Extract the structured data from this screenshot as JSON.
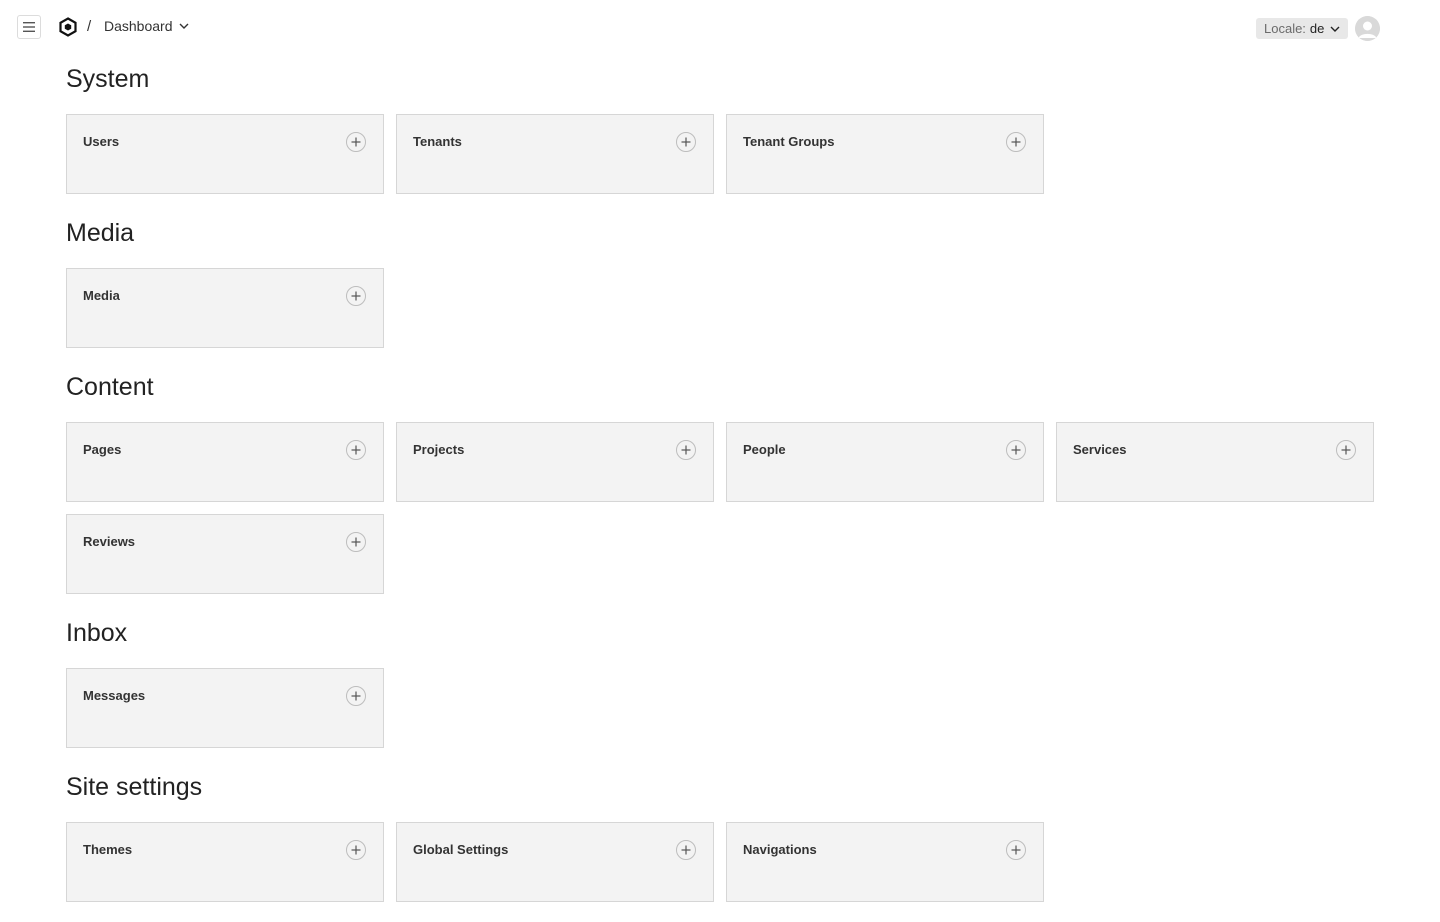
{
  "header": {
    "menu_icon": "hamburger-icon",
    "logo_icon": "hexagon-logo-icon",
    "breadcrumb_separator": "/",
    "breadcrumb_current": "Dashboard",
    "locale_label": "Locale:",
    "locale_value": "de",
    "avatar_icon": "user-avatar-icon"
  },
  "sections": [
    {
      "title": "System",
      "cards": [
        "Users",
        "Tenants",
        "Tenant Groups"
      ]
    },
    {
      "title": "Media",
      "cards": [
        "Media"
      ]
    },
    {
      "title": "Content",
      "cards": [
        "Pages",
        "Projects",
        "People",
        "Services",
        "Reviews"
      ]
    },
    {
      "title": "Inbox",
      "cards": [
        "Messages"
      ]
    },
    {
      "title": "Site settings",
      "cards": [
        "Themes",
        "Global Settings",
        "Navigations"
      ]
    }
  ],
  "colors": {
    "card_bg": "#f3f3f3",
    "card_border": "#d6d6d6",
    "locale_bg": "#e8e8e8"
  }
}
